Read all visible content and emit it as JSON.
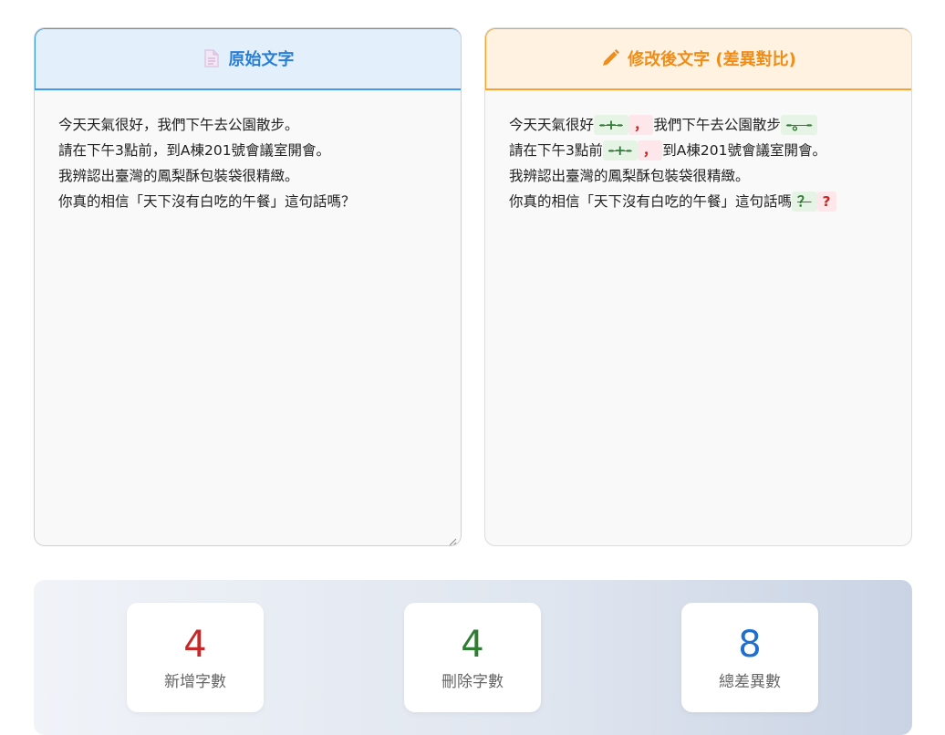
{
  "original": {
    "title": "原始文字",
    "icon": "document-icon",
    "text": "今天天氣很好，我們下午去公園散步。\n請在下午3點前，到A棟201號會議室開會。\n我辨認出臺灣的鳳梨酥包裝袋很精緻。\n你真的相信「天下沒有白吃的午餐」這句話嗎？"
  },
  "modified": {
    "title": "修改後文字 (差異對比)",
    "icon": "pencil-icon",
    "lines": [
      {
        "before": "今天天氣很好",
        "del": "-+-",
        "ins": "，",
        "after": "我們下午去公園散步",
        "del2": "-。-"
      },
      {
        "before": "請在下午3點前",
        "del": "-+-",
        "ins": "，",
        "after": "到A棟201號會議室開會。"
      },
      {
        "before": "我辨認出臺灣的鳳梨酥包裝袋很精緻。"
      },
      {
        "before": "你真的相信「天下沒有白吃的午餐」這句話嗎",
        "del": "？",
        "ins": "?"
      }
    ]
  },
  "stats": {
    "added": {
      "value": "4",
      "label": "新增字數",
      "color": "#c62828"
    },
    "deleted": {
      "value": "4",
      "label": "刪除字數",
      "color": "#2e7d32"
    },
    "total": {
      "value": "8",
      "label": "總差異數",
      "color": "#1e6fd0"
    }
  }
}
